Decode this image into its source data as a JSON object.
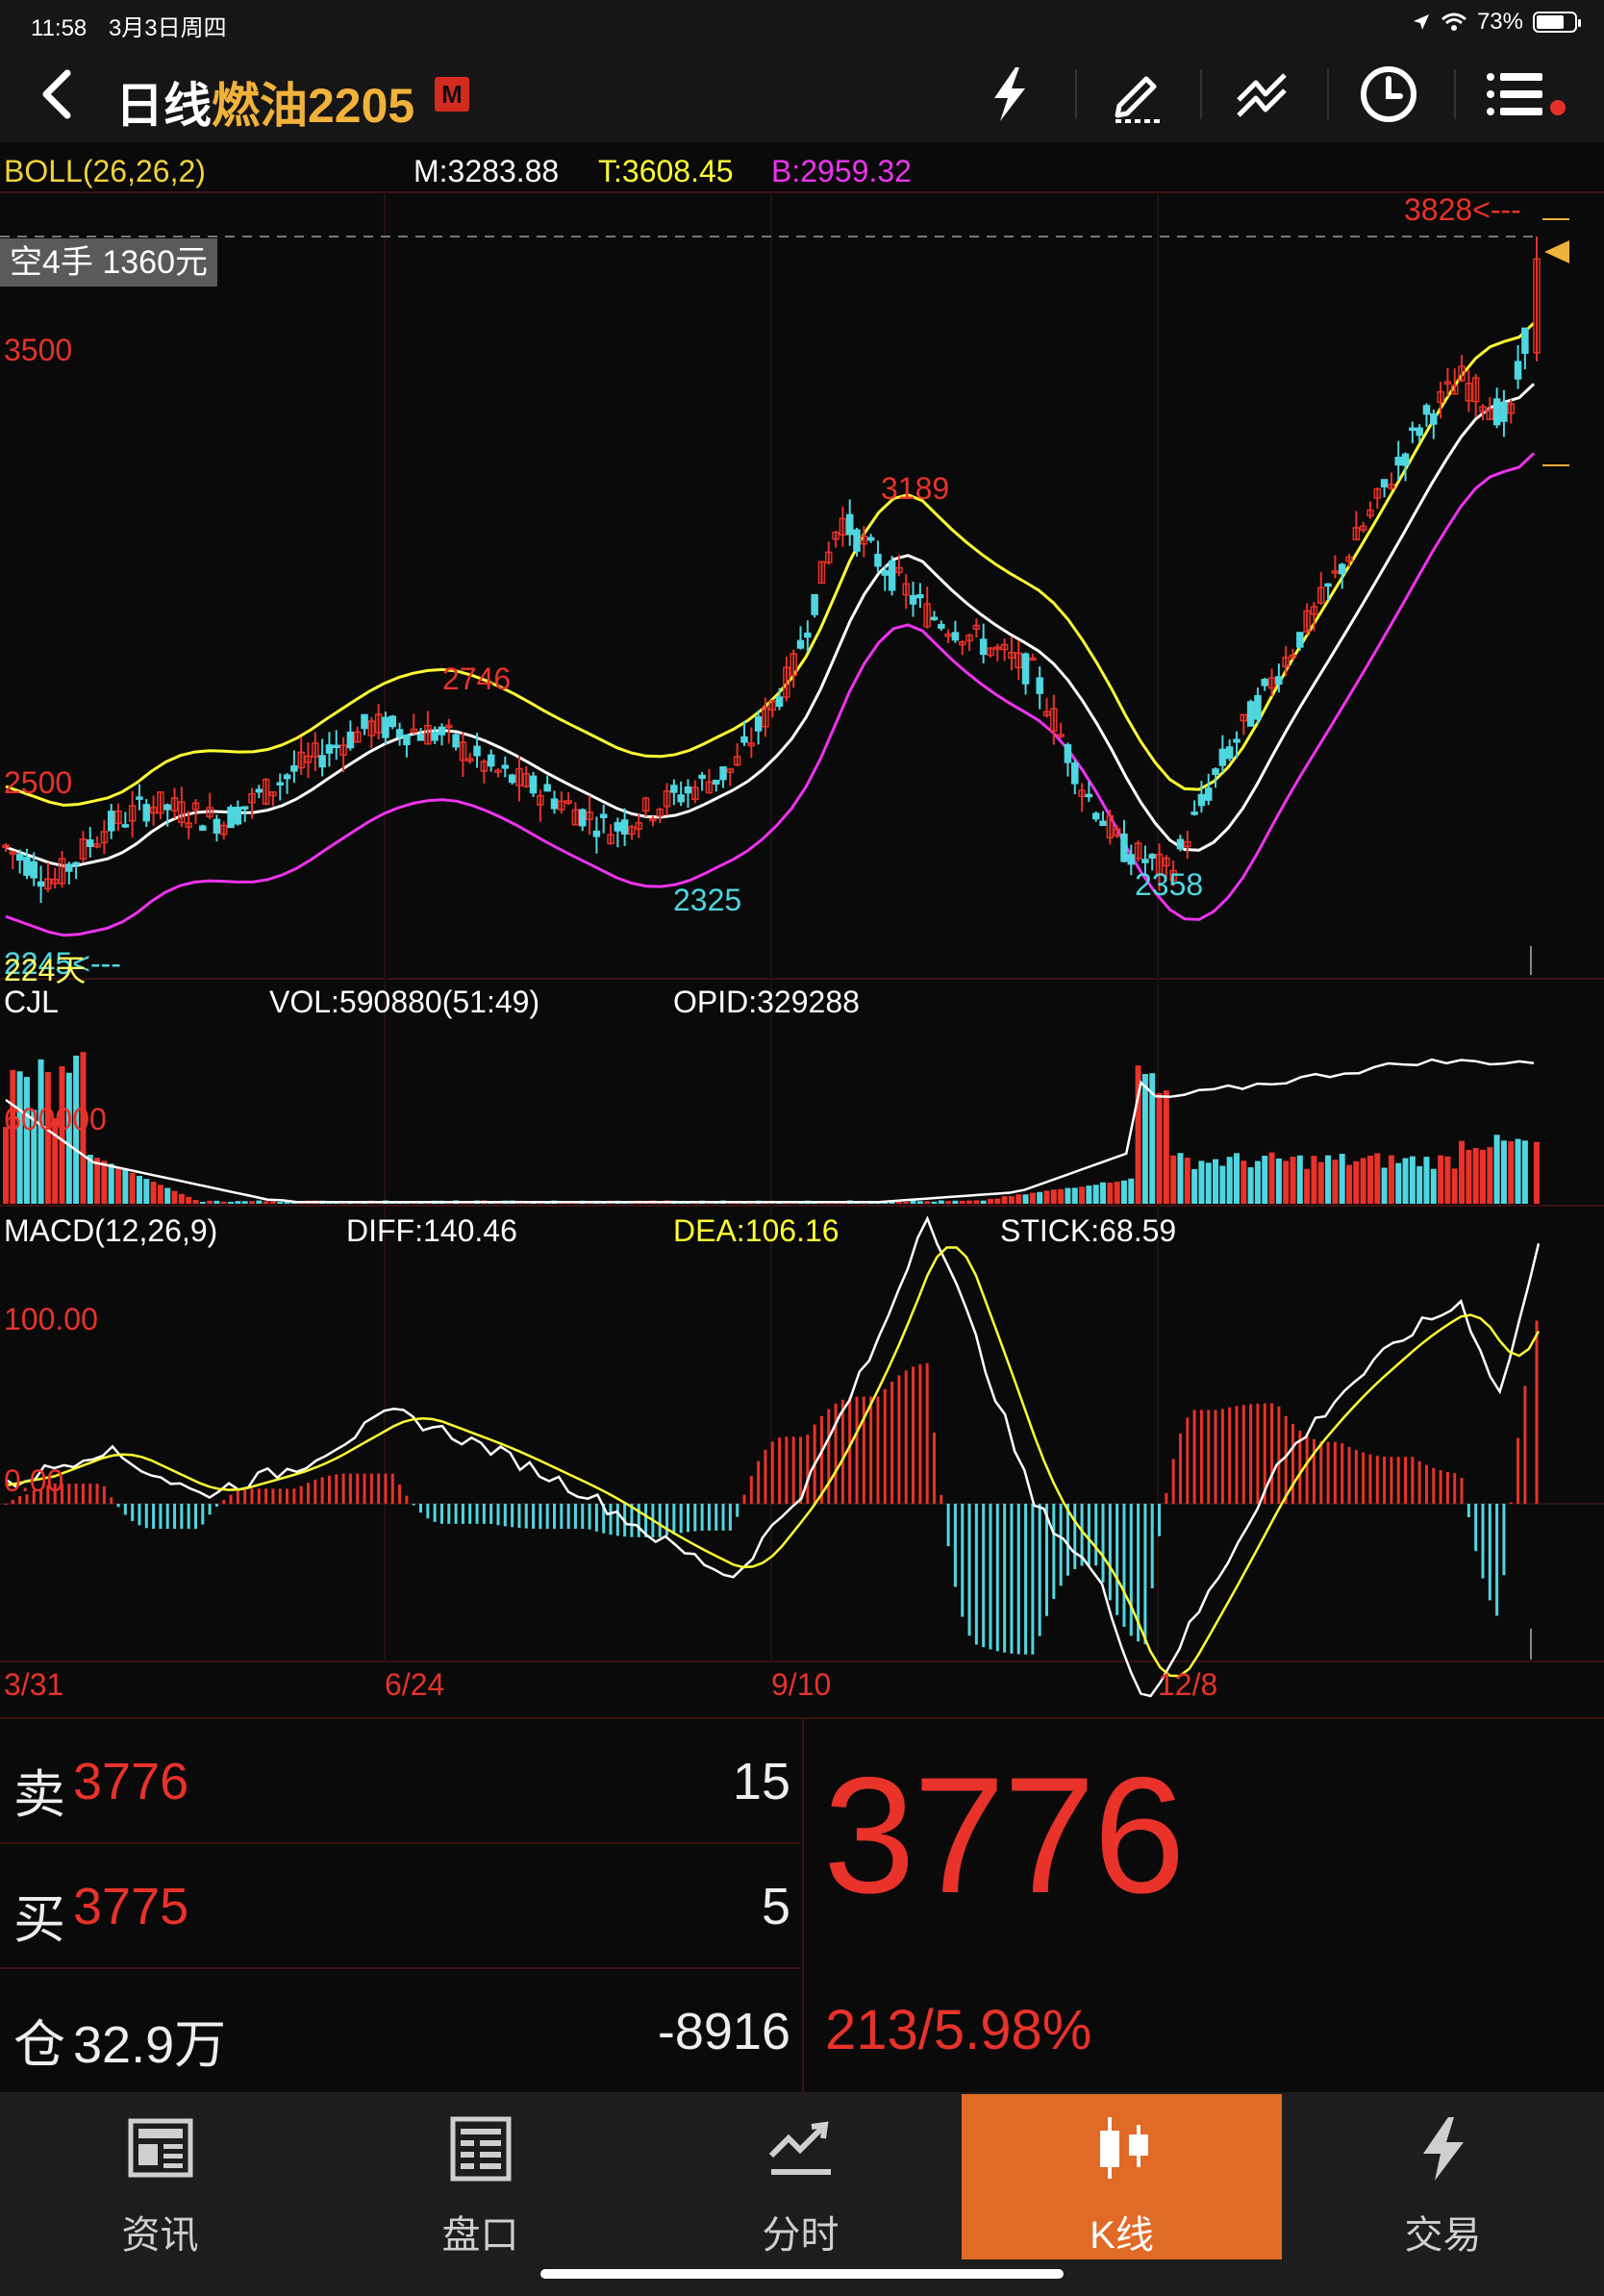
{
  "status_bar": {
    "time": "11:58",
    "date": "3月3日周四",
    "battery": "73%",
    "battery_level": 0.73
  },
  "header": {
    "prefix": "日线",
    "name": "燃油2205",
    "badge": "M",
    "icons": [
      "flash-icon",
      "draw-icon",
      "line-tool-icon",
      "clock-icon",
      "menu-icon"
    ]
  },
  "boll": {
    "label": "BOLL(26,26,2)",
    "m": "M:3283.88",
    "t": "T:3608.45",
    "b": "B:2959.32",
    "colors": {
      "m": "#ffffff",
      "t": "#ffff33",
      "b": "#ee33ee"
    }
  },
  "position_tag": "空4手 1360元",
  "price_labels": {
    "hi": "3828<---",
    "tick1": "3500",
    "tick2": "2500",
    "peak1": "2746",
    "peak2": "3189",
    "low1": "2325",
    "low2": "2358",
    "bottom": "2245<---",
    "bottom_overlay": "224天"
  },
  "cjl": {
    "label": "CJL",
    "vol": "VOL:590880(51:49)",
    "opid": "OPID:329288",
    "tick": "600000"
  },
  "macd": {
    "label": "MACD(12,26,9)",
    "diff": "DIFF:140.46",
    "dea": "DEA:106.16",
    "stick": "STICK:68.59",
    "tick_hi": "100.00",
    "tick_zero": "0.00"
  },
  "dates": [
    "3/31",
    "6/24",
    "9/10",
    "12/8"
  ],
  "quote": {
    "sell_label": "卖",
    "sell_price": "3776",
    "sell_qty": "15",
    "buy_label": "买",
    "buy_price": "3775",
    "buy_qty": "5",
    "oi_label": "仓",
    "oi_value": "32.9万",
    "oi_change": "-8916",
    "last": "3776",
    "change": "213/5.98%"
  },
  "tabs": [
    {
      "label": "资讯",
      "icon": "news-icon",
      "active": false
    },
    {
      "label": "盘口",
      "icon": "orderbook-icon",
      "active": false
    },
    {
      "label": "分时",
      "icon": "intraday-icon",
      "active": false
    },
    {
      "label": "K线",
      "icon": "candlestick-icon",
      "active": true
    },
    {
      "label": "交易",
      "icon": "trade-icon",
      "active": false
    }
  ],
  "colors": {
    "up": "#e8322a",
    "down": "#4fd6e0",
    "accent": "#e06a26",
    "gold": "#f0b23a"
  }
}
